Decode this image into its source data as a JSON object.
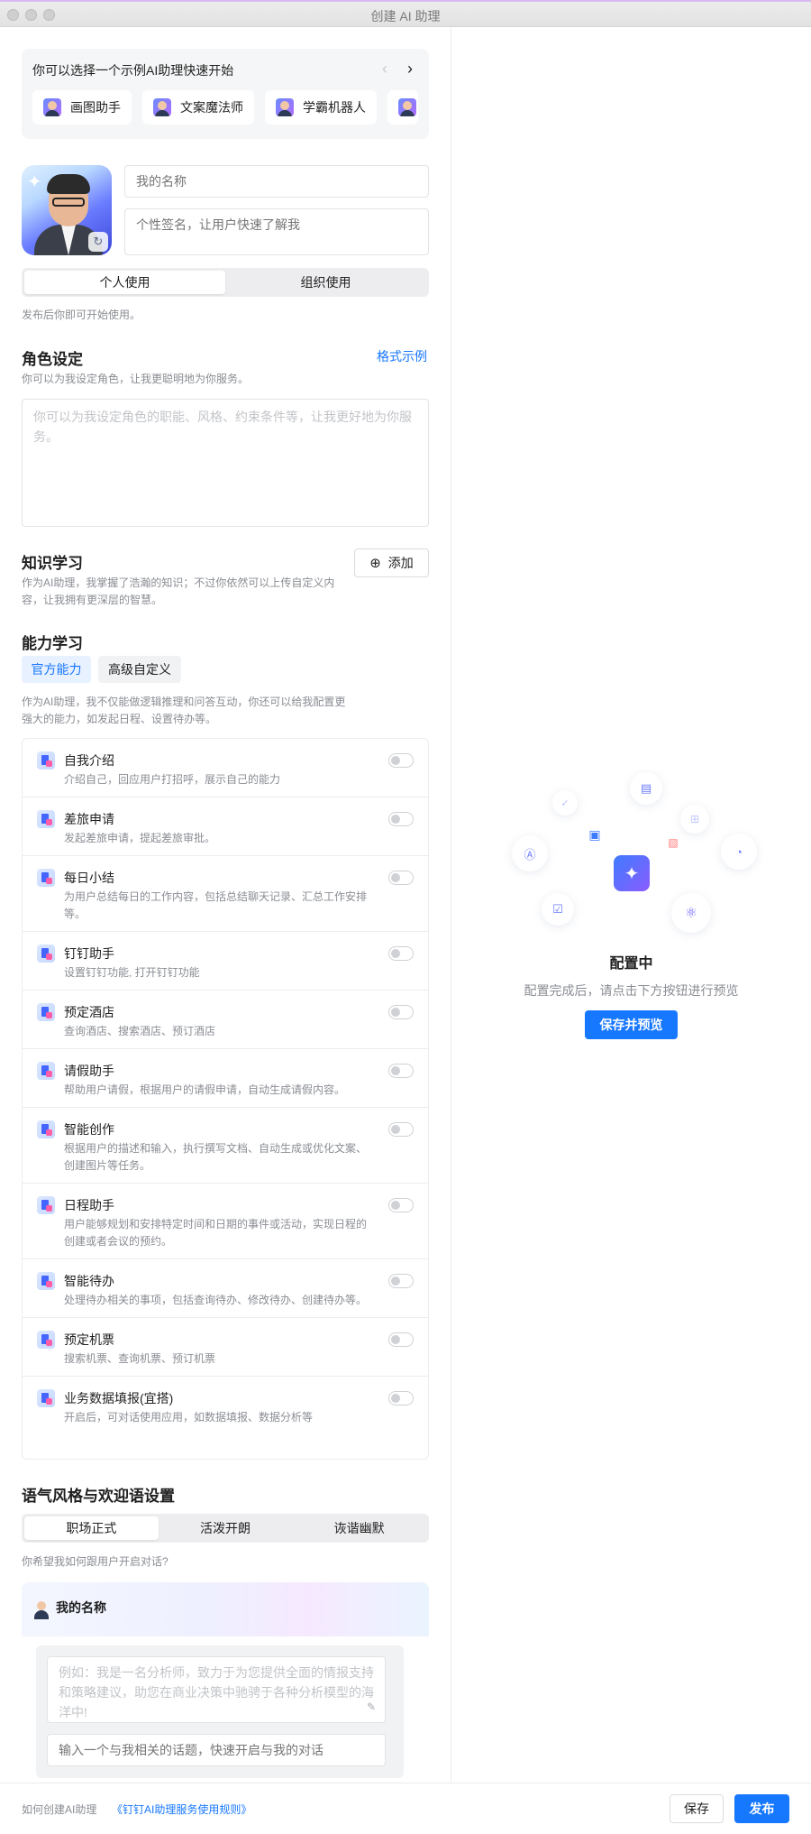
{
  "window": {
    "title": "创建 AI 助理"
  },
  "templates": {
    "heading": "你可以选择一个示例AI助理快速开始",
    "prev": "‹",
    "next": "›",
    "items": [
      "画图助手",
      "文案魔法师",
      "学霸机器人"
    ]
  },
  "profile": {
    "refresh_glyph": "↻",
    "sparkle_glyph": "✦",
    "name_placeholder": "我的名称",
    "signature_placeholder": "个性签名，让用户快速了解我"
  },
  "usage": {
    "options": [
      "个人使用",
      "组织使用"
    ],
    "selected": "个人使用",
    "hint": "发布后你即可开始使用。"
  },
  "role": {
    "title": "角色设定",
    "example_link": "格式示例",
    "hint": "你可以为我设定角色，让我更聪明地为你服务。",
    "placeholder": "你可以为我设定角色的职能、风格、约束条件等，让我更好地为你服务。"
  },
  "knowledge": {
    "title": "知识学习",
    "hint": "作为AI助理，我掌握了浩瀚的知识；不过你依然可以上传自定义内容，让我拥有更深层的智慧。",
    "add_icon": "⊕",
    "add_label": "添加"
  },
  "abilities": {
    "title": "能力学习",
    "tabs": [
      "官方能力",
      "高级自定义"
    ],
    "active_tab": "官方能力",
    "hint": "作为AI助理，我不仅能做逻辑推理和问答互动，你还可以给我配置更强大的能力，如发起日程、设置待办等。",
    "skills": [
      {
        "name": "自我介绍",
        "desc": "介绍自己，回应用户打招呼，展示自己的能力",
        "enabled": false
      },
      {
        "name": "差旅申请",
        "desc": "发起差旅申请，提起差旅审批。",
        "enabled": false
      },
      {
        "name": "每日小结",
        "desc": "为用户总结每日的工作内容，包括总结聊天记录、汇总工作安排等。",
        "enabled": false
      },
      {
        "name": "钉钉助手",
        "desc": "设置钉钉功能, 打开钉钉功能",
        "enabled": false
      },
      {
        "name": "预定酒店",
        "desc": "查询酒店、搜索酒店、预订酒店",
        "enabled": false
      },
      {
        "name": "请假助手",
        "desc": "帮助用户请假，根据用户的请假申请，自动生成请假内容。",
        "enabled": false
      },
      {
        "name": "智能创作",
        "desc": "根据用户的描述和输入，执行撰写文档、自动生成或优化文案、创建图片等任务。",
        "enabled": false
      },
      {
        "name": "日程助手",
        "desc": "用户能够规划和安排特定时间和日期的事件或活动，实现日程的创建或者会议的预约。",
        "enabled": false
      },
      {
        "name": "智能待办",
        "desc": "处理待办相关的事项，包括查询待办、修改待办、创建待办等。",
        "enabled": false
      },
      {
        "name": "预定机票",
        "desc": "搜索机票、查询机票、预订机票",
        "enabled": false
      },
      {
        "name": "业务数据填报(宜搭)",
        "desc": "开启后，可对话使用应用，如数据填报、数据分析等",
        "enabled": false
      }
    ]
  },
  "tone": {
    "title": "语气风格与欢迎语设置",
    "options": [
      "职场正式",
      "活泼开朗",
      "诙谐幽默"
    ],
    "selected": "职场正式",
    "hint": "你希望我如何跟用户开启对话?",
    "preview_name": "我的名称",
    "welcome_placeholder": "例如：我是一名分析师，致力于为您提供全面的情报支持和策略建议，助您在商业决策中驰骋于各种分析模型的海洋中!",
    "edit_icon": "✎",
    "topic_placeholder": "输入一个与我相关的话题，快速开启与我的对话"
  },
  "preview_panel": {
    "status": "配置中",
    "hint": "配置完成后，请点击下方按钮进行预览",
    "button": "保存并预览",
    "center_glyph": "✦"
  },
  "footer": {
    "help_link": "如何创建AI助理",
    "rules_link": "《钉钉AI助理服务使用规则》",
    "save": "保存",
    "publish": "发布"
  },
  "colors": {
    "accent": "#1677ff",
    "muted_text": "#8a8d93",
    "placeholder": "#c2c4c8"
  }
}
